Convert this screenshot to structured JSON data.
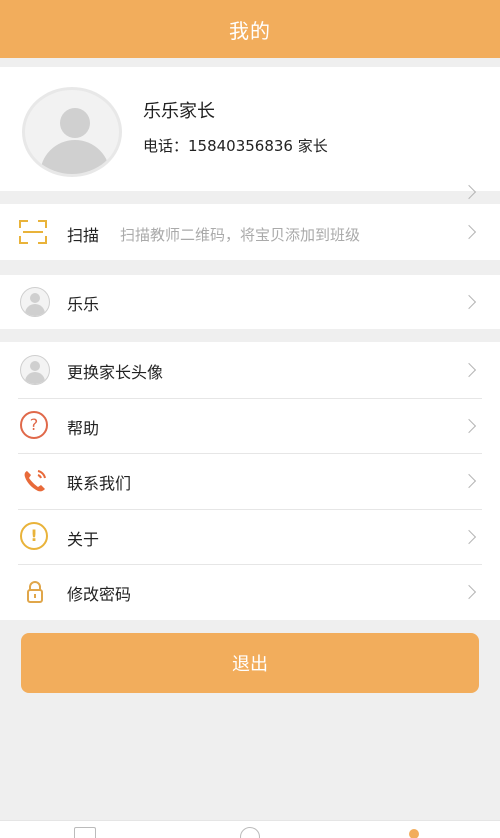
{
  "header": {
    "title": "我的"
  },
  "profile": {
    "name": "乐乐家长",
    "phone_line": "电话：15840356836 家长"
  },
  "scan": {
    "label": "扫描",
    "hint": "扫描教师二维码，将宝贝添加到班级"
  },
  "child": {
    "name": "乐乐"
  },
  "menu": {
    "items": [
      {
        "label": "更换家长头像",
        "icon": "user-avatar-icon"
      },
      {
        "label": "帮助",
        "icon": "question-icon"
      },
      {
        "label": "联系我们",
        "icon": "phone-icon"
      },
      {
        "label": "关于",
        "icon": "exclamation-icon"
      },
      {
        "label": "修改密码",
        "icon": "lock-icon"
      }
    ]
  },
  "logout": {
    "label": "退出"
  },
  "colors": {
    "accent": "#f2ad5c",
    "scan_icon": "#e9b33a",
    "help_icon": "#e0694a",
    "phone_icon": "#e86a3a",
    "about_icon": "#e9b33a",
    "lock_icon": "#e0a64a"
  }
}
